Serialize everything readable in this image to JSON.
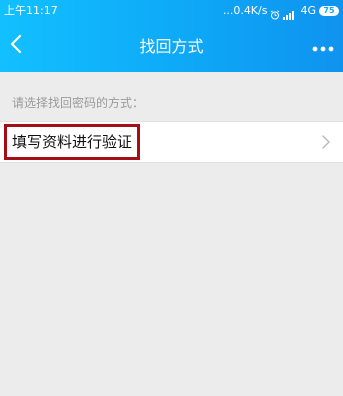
{
  "status_bar": {
    "time": "上午11:17",
    "network_speed": "...0.4K/s",
    "network_type": "4G",
    "battery_level": "75"
  },
  "nav": {
    "title": "找回方式",
    "back_icon": "back-chevron",
    "more_icon": "more-dots"
  },
  "content": {
    "section_label": "请选择找回密码的方式：",
    "options": [
      {
        "label": "填写资料进行验证",
        "icon": "chevron-right"
      }
    ]
  },
  "colors": {
    "header_gradient_start": "#12c0ff",
    "header_gradient_end": "#0f93ef",
    "page_background": "#ececec",
    "highlight_border": "#a50d17"
  }
}
